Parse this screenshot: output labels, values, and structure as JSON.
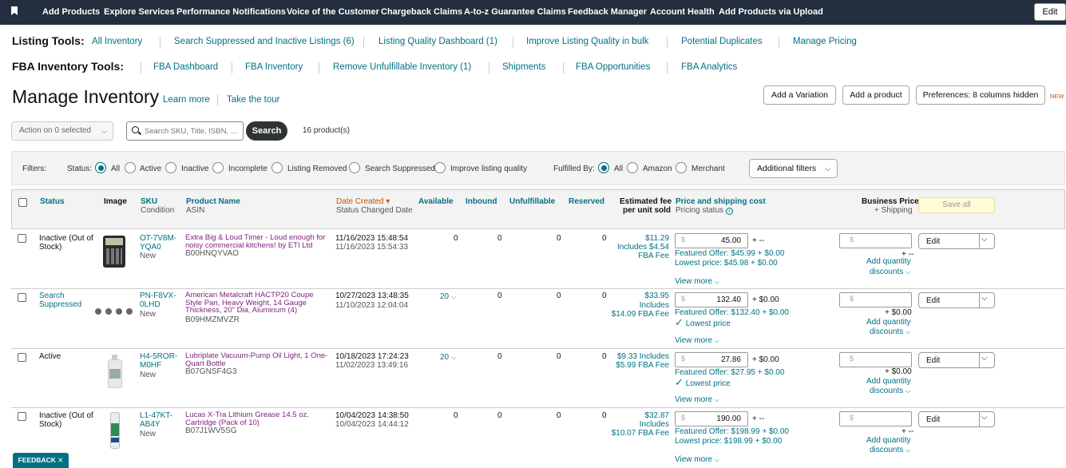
{
  "topnav": {
    "items": [
      "Add Products",
      "Explore Services",
      "Performance Notifications",
      "Voice of the Customer",
      "Chargeback Claims",
      "A-to-z Guarantee Claims",
      "Feedback Manager",
      "Account Health",
      "Add Products via Upload"
    ],
    "edit_label": "Edit"
  },
  "listing_tools": {
    "label": "Listing Tools:",
    "links": [
      "All Inventory",
      "Search Suppressed and Inactive Listings (6)",
      "Listing Quality Dashboard (1)",
      "Improve Listing Quality in bulk",
      "Potential Duplicates",
      "Manage Pricing"
    ]
  },
  "fba_tools": {
    "label": "FBA Inventory Tools:",
    "links": [
      "FBA Dashboard",
      "FBA Inventory",
      "Remove Unfulfillable Inventory (1)",
      "Shipments",
      "FBA Opportunities",
      "FBA Analytics"
    ]
  },
  "page": {
    "title": "Manage Inventory",
    "learn_more": "Learn more",
    "take_tour": "Take the tour",
    "add_variation": "Add a Variation",
    "add_product": "Add a product",
    "preferences": "Preferences: 8 columns hidden",
    "new_tag": "NEW"
  },
  "toolbar": {
    "action_label": "Action on 0 selected",
    "search_placeholder": "Search SKU, Title, ISBN, ...",
    "search_button": "Search",
    "product_count": "16 product(s)"
  },
  "filters": {
    "label": "Filters:",
    "status_label": "Status:",
    "status_options": [
      "All",
      "Active",
      "Inactive",
      "Incomplete",
      "Listing Removed",
      "Search Suppressed",
      "Improve listing quality"
    ],
    "status_selected": "All",
    "fulfilled_label": "Fulfilled By:",
    "fulfilled_options": [
      "All",
      "Amazon",
      "Merchant"
    ],
    "fulfilled_selected": "All",
    "additional_filters": "Additional filters"
  },
  "table": {
    "headers": {
      "status": "Status",
      "image": "Image",
      "sku": "SKU",
      "condition": "Condition",
      "product_name": "Product Name",
      "asin": "ASIN",
      "date_created": "Date Created",
      "status_changed": "Status Changed Date",
      "available": "Available",
      "inbound": "Inbound",
      "unfulfillable": "Unfulfillable",
      "reserved": "Reserved",
      "fee_line1": "Estimated fee",
      "fee_line2": "per unit sold",
      "price": "Price and shipping cost",
      "pricing_status": "Pricing status",
      "business_price": "Business Price",
      "shipping": "+ Shipping",
      "save_all": "Save all"
    },
    "rows": [
      {
        "status": "Inactive (Out of Stock)",
        "sku": "OT-7V8M-YQA0",
        "condition": "New",
        "name": "Extra Big & Loud Timer - Loud enough for noisy commercial kitchens! by ETI Ltd",
        "asin": "B00HNQYVAO",
        "created": "11/16/2023 15:48:54",
        "changed": "11/16/2023 15:54:33",
        "available": "0",
        "inbound": "0",
        "unfulfillable": "0",
        "reserved": "0",
        "fee_line1": "$11.29",
        "fee_line2": "Includes $4.54",
        "fee_line3": "FBA Fee",
        "price": "45.00",
        "shipping": "+ --",
        "featured": "Featured Offer: $45.99 + $0.00",
        "lowest": "Lowest price: $45.98 + $0.00",
        "view_more": "View more",
        "biz_ship": "+ --",
        "qty_discount": "Add quantity",
        "qty_discount2": "discounts",
        "edit": "Edit"
      },
      {
        "status": "Search Suppressed",
        "sku": "PN-F8VX-0LHD",
        "condition": "New",
        "name": "American Metalcraft HACTP20 Coupe Style Pan, Heavy Weight, 14 Gauge Thickness, 20\" Dia, Aluminum (4)",
        "asin": "B09HMZMVZR",
        "created": "10/27/2023 13:48:35",
        "changed": "11/10/2023 12:04:04",
        "available": "20",
        "inbound": "0",
        "unfulfillable": "0",
        "reserved": "0",
        "fee_line1": "$33.95",
        "fee_line2": "Includes",
        "fee_line3": "$14.09 FBA Fee",
        "price": "132.40",
        "shipping": "+ $0.00",
        "featured": "Featured Offer: $132.40 + $0.00",
        "lowest": "Lowest price",
        "view_more": "View more",
        "biz_ship": "+ $0.00",
        "qty_discount": "Add quantity",
        "qty_discount2": "discounts",
        "edit": "Edit"
      },
      {
        "status": "Active",
        "sku": "H4-5ROR-M0HF",
        "condition": "New",
        "name": "Lubriplate Vacuum-Pump Oil Light, 1 One-Quart Bottle",
        "asin": "B07GNSF4G3",
        "created": "10/18/2023 17:24:23",
        "changed": "11/02/2023 13:49:16",
        "available": "20",
        "inbound": "0",
        "unfulfillable": "0",
        "reserved": "0",
        "fee_line1": "$9.33 Includes",
        "fee_line2": "$5.99 FBA Fee",
        "fee_line3": "",
        "price": "27.86",
        "shipping": "+ $0.00",
        "featured": "Featured Offer: $27.95 + $0.00",
        "lowest": "Lowest price",
        "view_more": "View more",
        "biz_ship": "+ $0.00",
        "qty_discount": "Add quantity",
        "qty_discount2": "discounts",
        "edit": "Edit"
      },
      {
        "status": "Inactive (Out of Stock)",
        "sku": "L1-47KT-AB4Y",
        "condition": "New",
        "name": "Lucas X-Tra Lithium Grease 14.5 oz. Cartridge (Pack of 10)",
        "asin": "B07J1WV5SG",
        "created": "10/04/2023 14:38:50",
        "changed": "10/04/2023 14:44:12",
        "available": "0",
        "inbound": "0",
        "unfulfillable": "0",
        "reserved": "0",
        "fee_line1": "$32.87",
        "fee_line2": "Includes",
        "fee_line3": "$10.07 FBA Fee",
        "price": "190.00",
        "shipping": "+ --",
        "featured": "Featured Offer: $198.99 + $0.00",
        "lowest": "Lowest price: $198.99 + $0.00",
        "view_more": "View more",
        "biz_ship": "+ --",
        "qty_discount": "Add quantity",
        "qty_discount2": "discounts",
        "edit": "Edit"
      }
    ]
  },
  "feedback": "FEEDBACK ✕",
  "colors": {
    "nav": "#232f3e",
    "link": "#007185",
    "accent_orange": "#c45500",
    "product_link": "#7c1f7c",
    "ok_green": "#067d62"
  }
}
